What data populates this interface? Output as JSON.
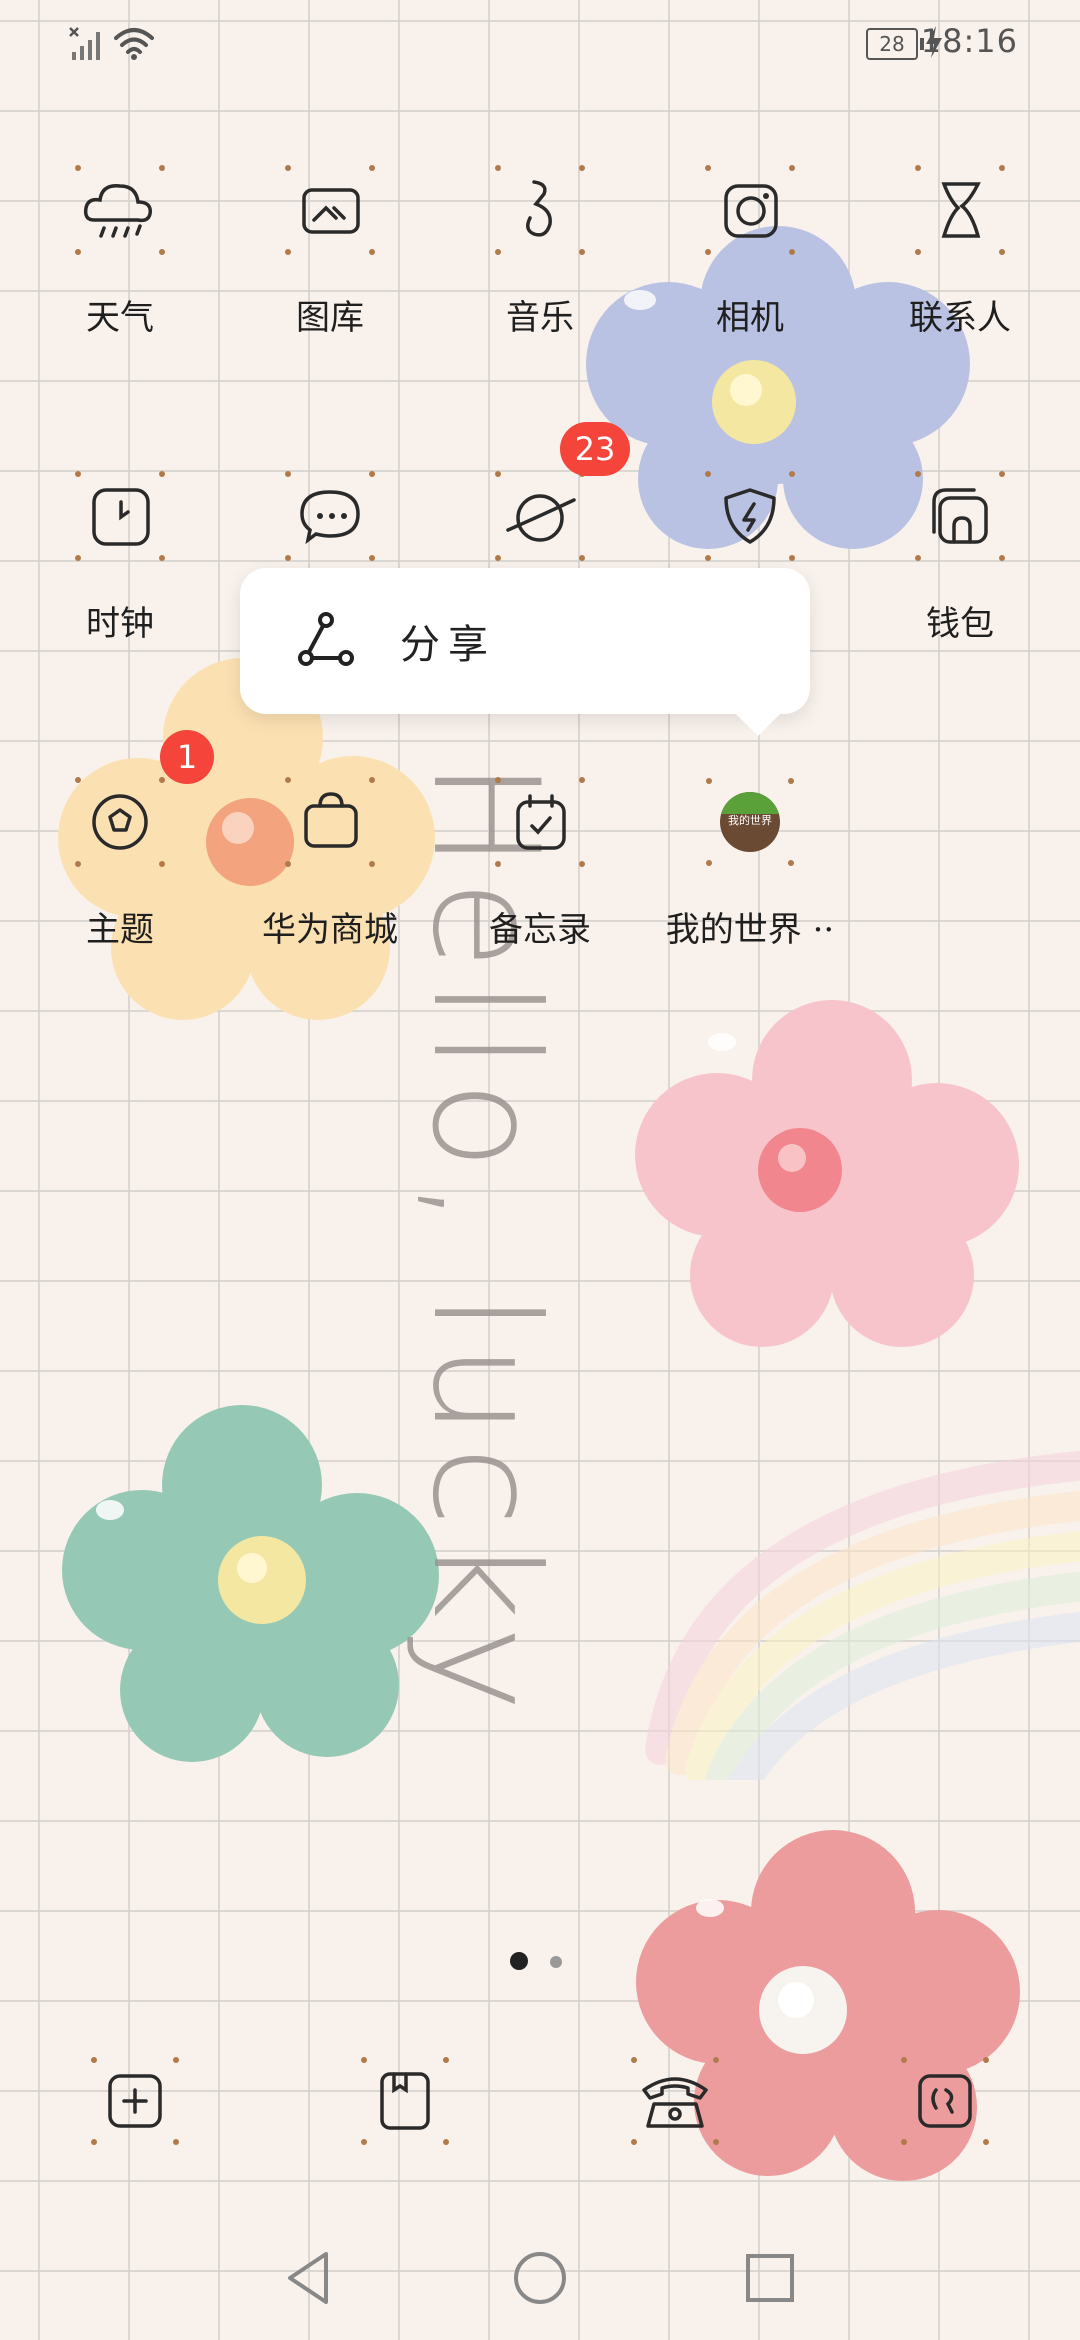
{
  "status_bar": {
    "time": "18:16",
    "battery_level": "28",
    "icons": [
      "no-signal-icon",
      "wifi-icon",
      "battery-icon",
      "charging-icon"
    ]
  },
  "apps": [
    {
      "label": "天气",
      "icon": "weather-icon"
    },
    {
      "label": "图库",
      "icon": "gallery-icon"
    },
    {
      "label": "音乐",
      "icon": "music-icon"
    },
    {
      "label": "相机",
      "icon": "camera-icon"
    },
    {
      "label": "联系人",
      "icon": "contacts-icon"
    },
    {
      "label": "时钟",
      "icon": "clock-icon"
    },
    {
      "label": "",
      "icon": "messages-icon"
    },
    {
      "label": "",
      "icon": "browser-icon",
      "badge": "23"
    },
    {
      "label": "",
      "icon": "security-icon"
    },
    {
      "label": "钱包",
      "icon": "wallet-icon"
    },
    {
      "label": "主题",
      "icon": "themes-icon",
      "badge": "1"
    },
    {
      "label": "华为商城",
      "icon": "store-icon"
    },
    {
      "label": "备忘录",
      "icon": "notepad-icon"
    },
    {
      "label": "我的世界 ··",
      "icon": "minecraft-icon",
      "icon_text": "我的世界"
    }
  ],
  "hidden_label_fragment": "l",
  "popup": {
    "label": "分享",
    "icon": "share-icon"
  },
  "wallpaper_text": "Hello, lucky",
  "page_indicator": {
    "current": 1,
    "total": 2
  },
  "dock": [
    "add-icon",
    "book-icon",
    "phone-icon",
    "tool-icon"
  ],
  "nav_bar": [
    "back-icon",
    "home-icon",
    "recents-icon"
  ],
  "colors": {
    "badge": "#f5443a",
    "background": "#f9f2ec",
    "grid": "#d6d2ce"
  }
}
